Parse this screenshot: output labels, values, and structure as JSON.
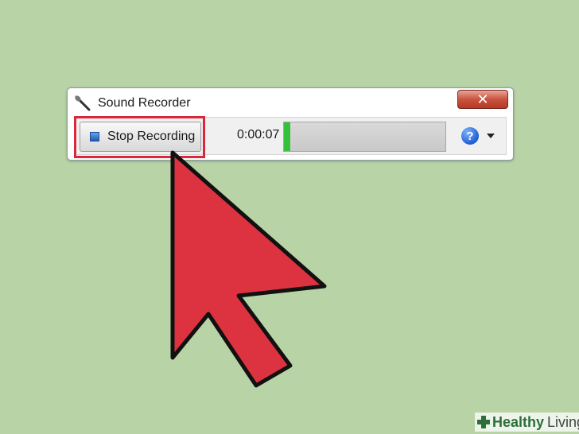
{
  "window": {
    "title": "Sound Recorder",
    "close_label": "✕"
  },
  "toolbar": {
    "stop_label": "Stop Recording",
    "elapsed_time": "0:00:07",
    "level_fraction": 0.02,
    "help_label": "?"
  },
  "overlay": {
    "watermark_bold": "Healthy",
    "watermark_regular": "Living"
  },
  "colors": {
    "background": "#b8d3a6",
    "arrow": "#dd3340",
    "highlight": "#d8283a",
    "level": "#35c13c"
  },
  "icons": [
    "microphone-icon",
    "close-icon",
    "stop-icon",
    "help-icon",
    "chevron-down-icon",
    "cursor-arrow-icon",
    "health-cross-icon"
  ]
}
